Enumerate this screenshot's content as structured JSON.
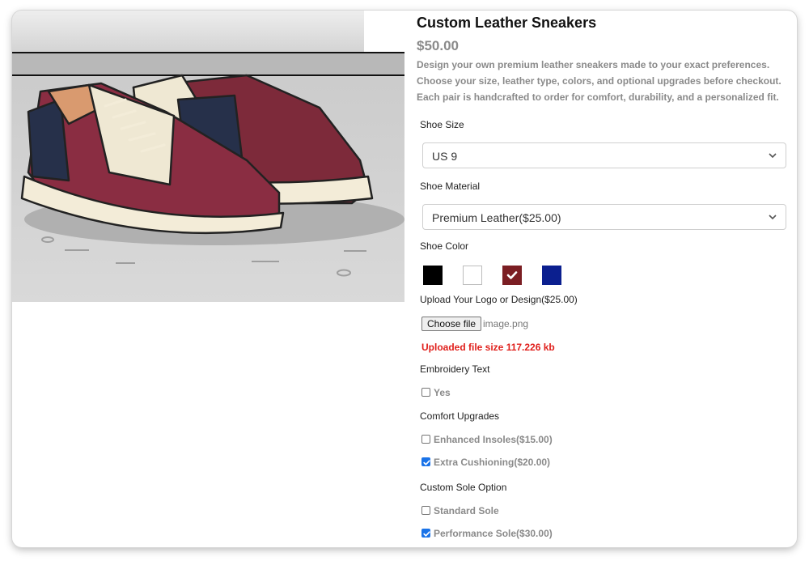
{
  "product": {
    "title": "Custom Leather Sneakers",
    "price": "$50.00",
    "description_lines": [
      "Design your own premium leather sneakers made to your exact preferences.",
      "Choose your size, leather type, colors, and optional upgrades before checkout.",
      "Each pair is handcrafted to order for comfort, durability, and a personalized fit."
    ],
    "image_icon": "sneaker-illustration"
  },
  "options": {
    "size": {
      "label": "Shoe Size",
      "value": "US 9"
    },
    "material": {
      "label": "Shoe Material",
      "value": "Premium Leather($25.00)"
    },
    "color": {
      "label": "Shoe Color",
      "swatches": [
        {
          "color": "#000000",
          "selected": false
        },
        {
          "color": "#ffffff",
          "selected": false
        },
        {
          "color": "#7b1e23",
          "selected": true
        },
        {
          "color": "#0b1f8f",
          "selected": false
        }
      ]
    },
    "upload": {
      "label": "Upload Your Logo or Design($25.00)",
      "button_label": "Choose file",
      "file_name": "image.png",
      "file_size_text": "Uploaded file size 117.226 kb"
    },
    "embroidery": {
      "label": "Embroidery Text",
      "options": [
        {
          "label": "Yes",
          "checked": false
        }
      ]
    },
    "comfort": {
      "label": "Comfort Upgrades",
      "options": [
        {
          "label": "Enhanced Insoles($15.00)",
          "checked": false
        },
        {
          "label": "Extra Cushioning($20.00)",
          "checked": true
        }
      ]
    },
    "sole": {
      "label": "Custom Sole Option",
      "options": [
        {
          "label": "Standard Sole",
          "checked": false
        },
        {
          "label": "Performance Sole($30.00)",
          "checked": true
        }
      ]
    }
  },
  "colors": {
    "checkbox_accent": "#1a73e8",
    "file_size_text": "#e0201c",
    "muted_text": "#8a8a8a"
  }
}
